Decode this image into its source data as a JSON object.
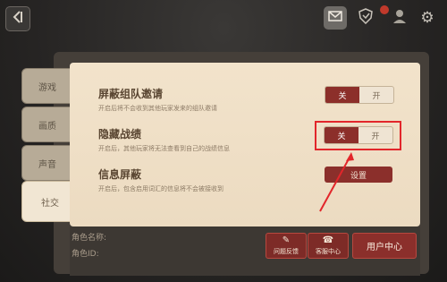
{
  "topbar": {
    "back_icon": "back-arrow-icon",
    "mail_icon": "mail-icon",
    "shield_icon": "shield-icon",
    "user_icon": "user-icon",
    "gear_icon": "gear-icon"
  },
  "sidebar": {
    "items": [
      {
        "label": "游戏"
      },
      {
        "label": "画质"
      },
      {
        "label": "声音"
      },
      {
        "label": "社交"
      }
    ],
    "active_index": 3
  },
  "settings": {
    "block_invite": {
      "title": "屏蔽组队邀请",
      "desc": "开启后将不会收到其他玩家发来的组队邀请",
      "off": "关",
      "on": "开"
    },
    "hide_record": {
      "title": "隐藏战绩",
      "desc": "开启后，其他玩家将无法查看到自己的战绩信息",
      "off": "关",
      "on": "开"
    },
    "message_block": {
      "title": "信息屏蔽",
      "desc": "开启后，包含启用词汇的信息将不会被接收到",
      "button": "设置"
    }
  },
  "account": {
    "role_name_label": "角色名称:",
    "role_id_label": "角色ID:"
  },
  "bottom_buttons": {
    "feedback": "问题反馈",
    "customer": "客服中心",
    "user_center": "用户中心"
  },
  "colors": {
    "accent_red": "#8b2f2b",
    "highlight_red": "#e2262b",
    "panel_bg": "#f2e3cb"
  }
}
